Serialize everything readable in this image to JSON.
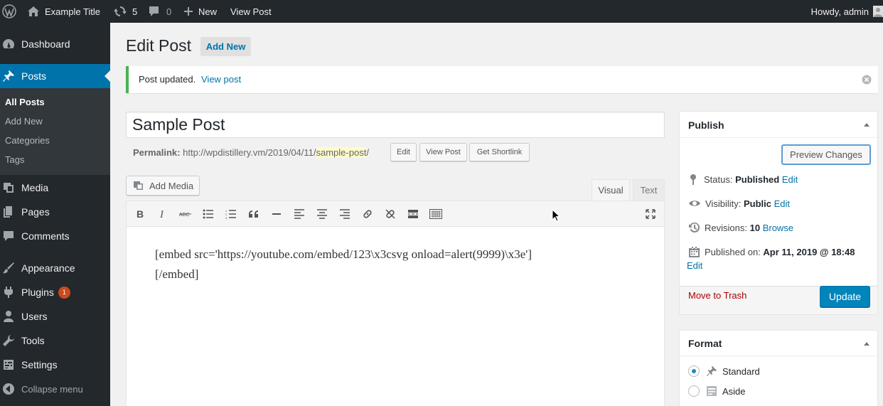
{
  "adminbar": {
    "site_title": "Example Title",
    "updates_count": "5",
    "comments_count": "0",
    "new_label": "New",
    "view_post_label": "View Post",
    "howdy": "Howdy, admin"
  },
  "sidebar": {
    "dashboard": "Dashboard",
    "posts": "Posts",
    "submenu": [
      "All Posts",
      "Add New",
      "Categories",
      "Tags"
    ],
    "media": "Media",
    "pages": "Pages",
    "comments": "Comments",
    "appearance": "Appearance",
    "plugins": "Plugins",
    "plugins_badge": "1",
    "users": "Users",
    "tools": "Tools",
    "settings": "Settings",
    "collapse": "Collapse menu"
  },
  "header": {
    "title": "Edit Post",
    "add_new": "Add New"
  },
  "notice": {
    "text": "Post updated.",
    "link": "View post"
  },
  "post": {
    "title": "Sample Post",
    "permalink_label": "Permalink:",
    "permalink_base": "http://wpdistillery.vm/2019/04/11/",
    "permalink_slug": "sample-post",
    "permalink_end": "/",
    "edit_btn": "Edit",
    "view_btn": "View Post",
    "shortlink_btn": "Get Shortlink"
  },
  "editor": {
    "add_media": "Add Media",
    "tab_visual": "Visual",
    "tab_text": "Text",
    "toolbar_icons": [
      "bold-icon",
      "italic-icon",
      "strikethrough-icon",
      "bulleted-list-icon",
      "numbered-list-icon",
      "blockquote-icon",
      "horizontal-line-icon",
      "align-left-icon",
      "align-center-icon",
      "align-right-icon",
      "insert-link-icon",
      "remove-link-icon",
      "read-more-icon",
      "toolbar-toggle-icon",
      "fullscreen-icon"
    ],
    "content_line1": "[embed src='https://youtube.com/embed/123\\x3csvg onload=alert(9999)\\x3e']",
    "content_line2": "[/embed]"
  },
  "publish": {
    "title": "Publish",
    "preview_btn": "Preview Changes",
    "status_label": "Status:",
    "status_value": "Published",
    "visibility_label": "Visibility:",
    "visibility_value": "Public",
    "revisions_label": "Revisions:",
    "revisions_value": "10",
    "browse": "Browse",
    "published_label": "Published on:",
    "published_value": "Apr 11, 2019 @ 18:48",
    "edit": "Edit",
    "trash": "Move to Trash",
    "update_btn": "Update"
  },
  "format": {
    "title": "Format",
    "options": [
      {
        "label": "Standard",
        "checked": true
      },
      {
        "label": "Aside",
        "checked": false
      }
    ]
  },
  "colors": {
    "accent": "#0073aa",
    "adminbar": "#23282d",
    "notice_border": "#46b450",
    "trash": "#a00"
  }
}
